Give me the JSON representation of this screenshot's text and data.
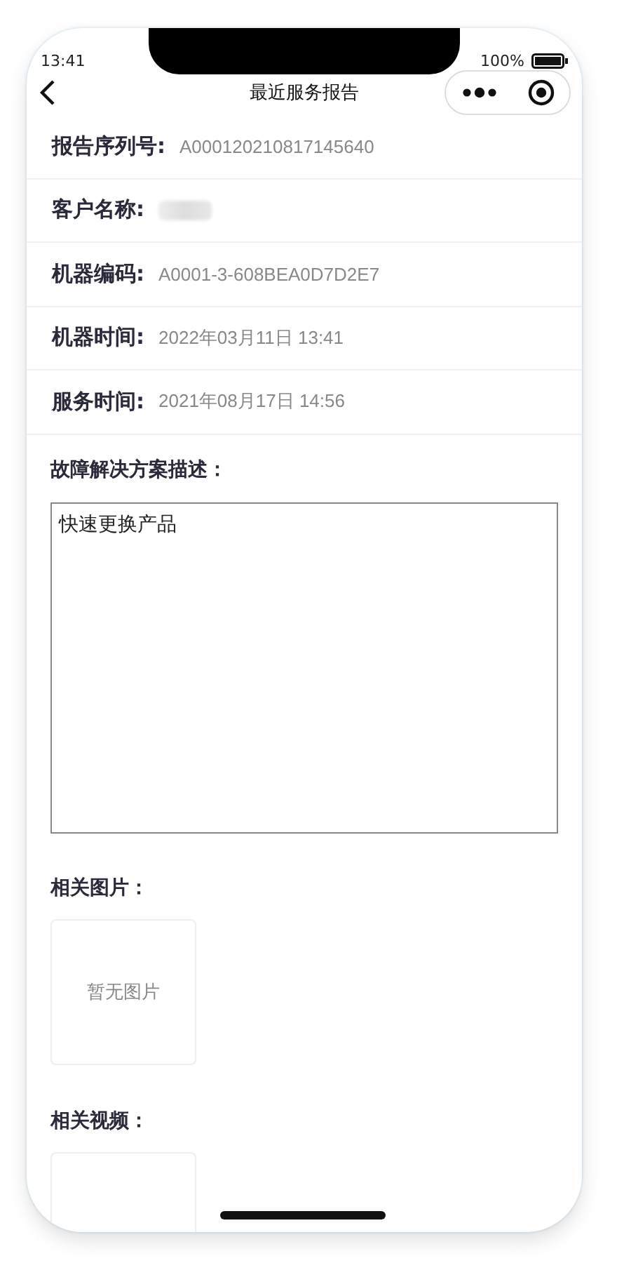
{
  "status_bar": {
    "time": "13:41",
    "battery": "100%"
  },
  "nav": {
    "title": "最近服务报告"
  },
  "fields": [
    {
      "kind": "text",
      "label": "报告序列号:",
      "value": "A000120210817145640"
    },
    {
      "kind": "redacted",
      "label": "客户名称:"
    },
    {
      "kind": "text",
      "label": "机器编码:",
      "value": "A0001-3-608BEA0D7D2E7"
    },
    {
      "kind": "text",
      "label": "机器时间:",
      "value": "2022年03月11日 13:41"
    },
    {
      "kind": "text",
      "label": "服务时间:",
      "value": "2021年08月17日 14:56"
    }
  ],
  "description": {
    "label": "故障解决方案描述：",
    "value": "快速更换产品"
  },
  "images": {
    "label": "相关图片：",
    "empty_text": "暂无图片"
  },
  "videos": {
    "label": "相关视频："
  }
}
